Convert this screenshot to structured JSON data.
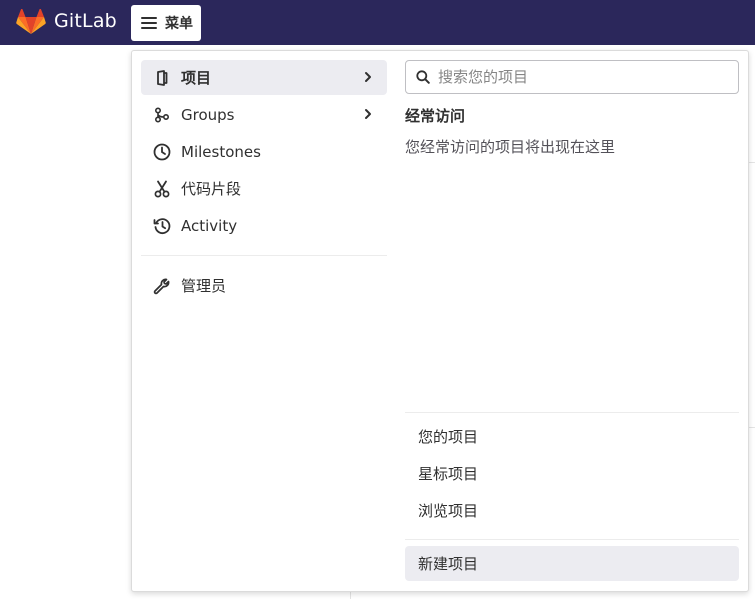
{
  "navbar": {
    "brand": "GitLab",
    "menu_label": "菜单",
    "bg_color": "#2b275b",
    "logo_colors": [
      "#e24329",
      "#fc6d26",
      "#fca326"
    ]
  },
  "menu": {
    "items": [
      {
        "label": "项目",
        "icon": "project-icon",
        "active": true,
        "has_submenu": true
      },
      {
        "label": "Groups",
        "icon": "group-icon",
        "active": false,
        "has_submenu": true
      },
      {
        "label": "Milestones",
        "icon": "clock-icon",
        "active": false,
        "has_submenu": false
      },
      {
        "label": "代码片段",
        "icon": "scissors-icon",
        "active": false,
        "has_submenu": false
      },
      {
        "label": "Activity",
        "icon": "history-icon",
        "active": false,
        "has_submenu": false
      }
    ],
    "admin": {
      "label": "管理员",
      "icon": "wrench-icon"
    }
  },
  "projects_panel": {
    "search_placeholder": "搜索您的项目",
    "frequent_title": "经常访问",
    "frequent_empty": "您经常访问的项目将出现在这里",
    "links": [
      "您的项目",
      "星标项目",
      "浏览项目"
    ],
    "new_project": "新建项目"
  },
  "colors": {
    "active_bg": "#ececf1",
    "text": "#303030",
    "muted": "#868686"
  }
}
